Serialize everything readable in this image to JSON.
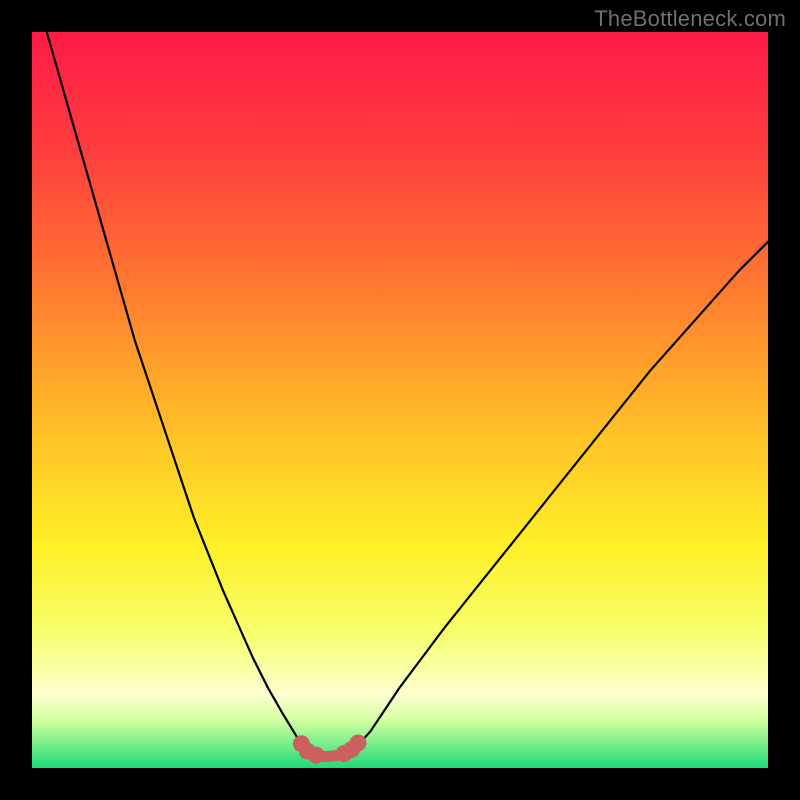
{
  "watermark": "TheBottleneck.com",
  "chart_data": {
    "type": "line",
    "title": "",
    "xlabel": "",
    "ylabel": "",
    "xlim": [
      0,
      100
    ],
    "ylim": [
      0,
      100
    ],
    "grid": false,
    "legend": false,
    "series": [
      {
        "name": "left-curve",
        "x": [
          2,
          4,
          6,
          8,
          10,
          12,
          14,
          16,
          18,
          20,
          22,
          24,
          26,
          28,
          30,
          32,
          34,
          36,
          36.8
        ],
        "y": [
          100,
          93,
          86,
          79,
          72,
          65,
          58,
          52,
          46,
          40,
          34,
          29,
          24,
          19.5,
          15,
          11,
          7.5,
          4.2,
          2.8
        ]
      },
      {
        "name": "right-curve",
        "x": [
          44.2,
          46,
          48,
          50,
          53,
          56,
          60,
          64,
          68,
          72,
          76,
          80,
          84,
          88,
          92,
          96,
          100
        ],
        "y": [
          3.0,
          5,
          8,
          11,
          15,
          19,
          24,
          29,
          34,
          39,
          44,
          49,
          54,
          58.5,
          63,
          67.5,
          71.5
        ]
      },
      {
        "name": "valley-floor",
        "x": [
          36.8,
          37.5,
          38.5,
          40,
          41.5,
          43,
          44.2
        ],
        "y": [
          2.8,
          2.1,
          1.7,
          1.55,
          1.7,
          2.2,
          3.0
        ]
      }
    ],
    "markers": [
      {
        "name": "valley-dot",
        "x": 36.6,
        "y": 3.3
      },
      {
        "name": "valley-dot",
        "x": 37.4,
        "y": 2.3
      },
      {
        "name": "valley-dot",
        "x": 38.6,
        "y": 1.75
      },
      {
        "name": "valley-dot",
        "x": 42.4,
        "y": 1.95
      },
      {
        "name": "valley-dot",
        "x": 43.4,
        "y": 2.5
      },
      {
        "name": "valley-dot",
        "x": 44.3,
        "y": 3.4
      }
    ],
    "background_gradient": {
      "stops": [
        {
          "offset": 0.0,
          "color": "#ff1b47"
        },
        {
          "offset": 0.15,
          "color": "#ff3a3f"
        },
        {
          "offset": 0.35,
          "color": "#ff7a2f"
        },
        {
          "offset": 0.55,
          "color": "#ffc326"
        },
        {
          "offset": 0.7,
          "color": "#fff028"
        },
        {
          "offset": 0.82,
          "color": "#f6ff70"
        },
        {
          "offset": 0.9,
          "color": "#fdffd0"
        },
        {
          "offset": 0.935,
          "color": "#d3ffa0"
        },
        {
          "offset": 0.965,
          "color": "#7fef8c"
        },
        {
          "offset": 1.0,
          "color": "#1edc78"
        }
      ]
    },
    "colors": {
      "curve": "#000000",
      "valley_stroke": "#cb6060",
      "marker_fill": "#cb6060"
    }
  }
}
